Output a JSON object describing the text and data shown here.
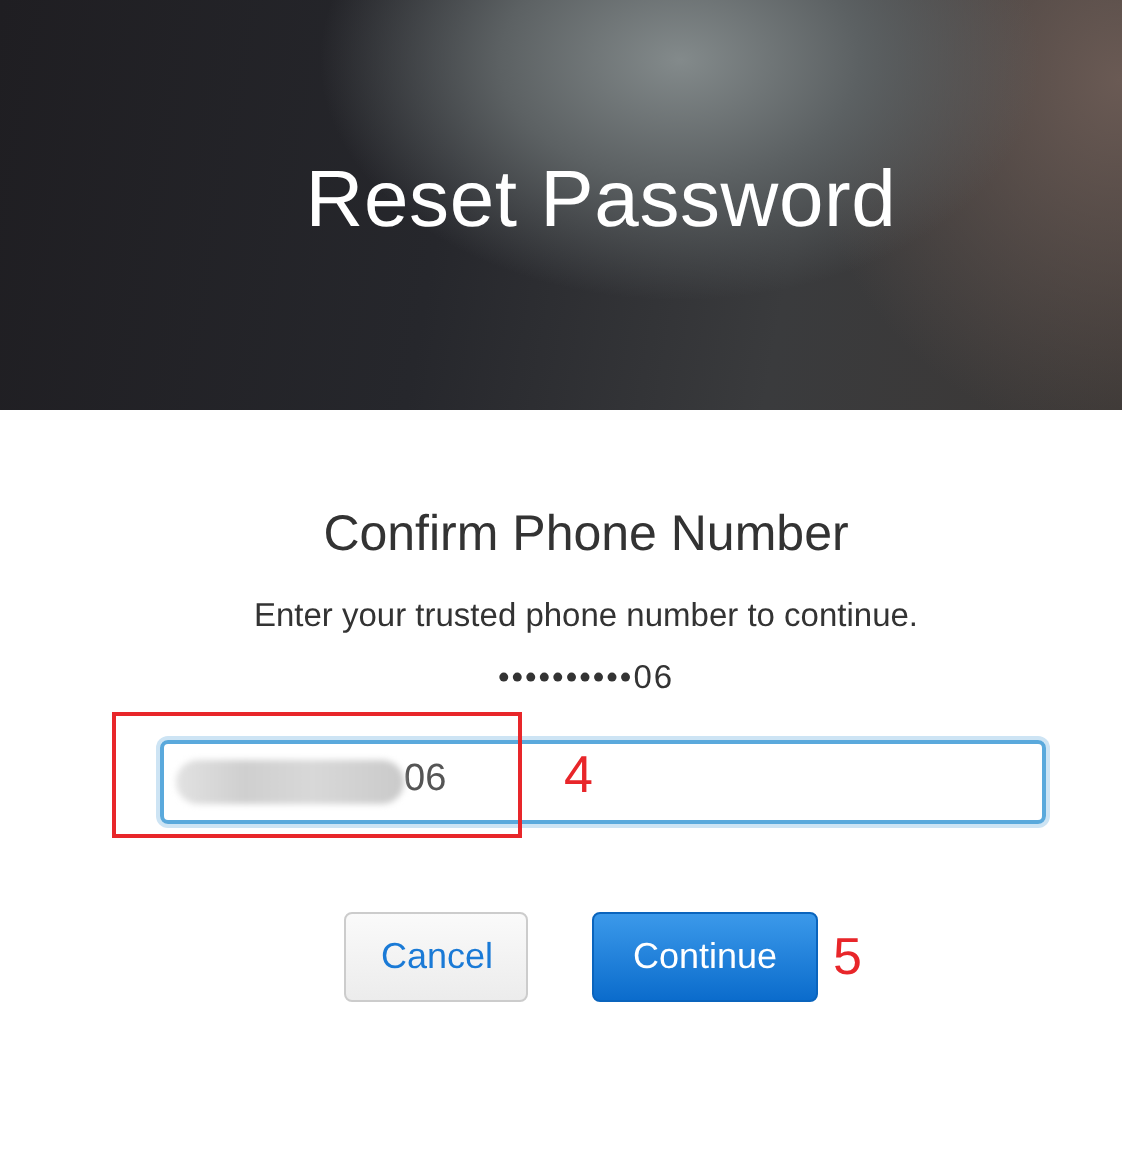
{
  "header": {
    "title": "Reset Password"
  },
  "heading": "Confirm Phone Number",
  "instructions": "Enter your trusted phone number to continue.",
  "masked_number": "••••••••••06",
  "phone_field": {
    "value": "06",
    "redacted": true,
    "annotation": "4"
  },
  "buttons": [
    {
      "label": "Cancel",
      "kind": "secondary"
    },
    {
      "label": "Continue",
      "kind": "primary",
      "annotation": "5"
    }
  ]
}
